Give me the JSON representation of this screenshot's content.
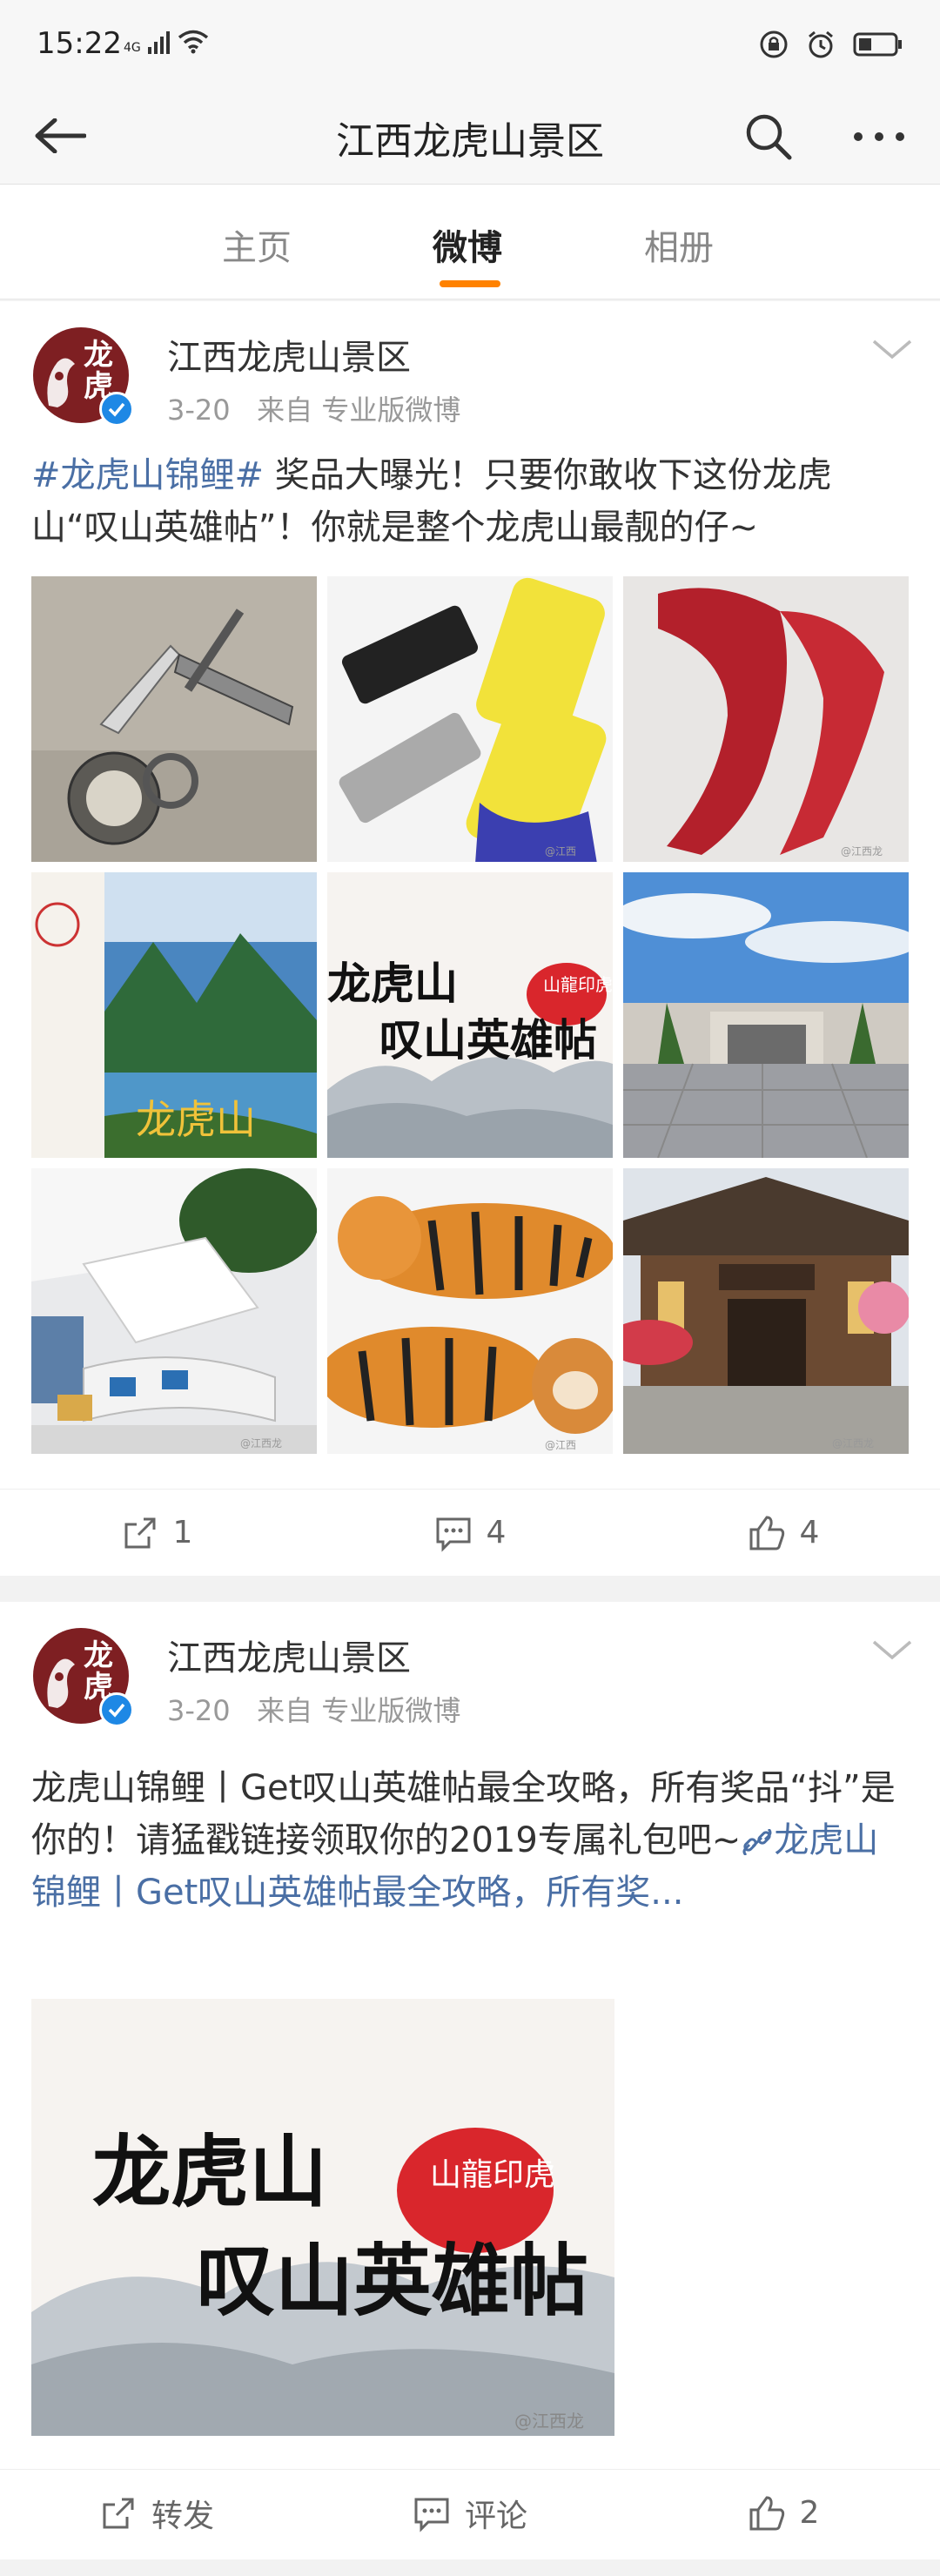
{
  "status": {
    "time": "15:22",
    "network": "4G"
  },
  "nav": {
    "title": "江西龙虎山景区",
    "back_icon": "back-arrow-icon",
    "search_icon": "search-icon",
    "more_icon": "more-dots-icon"
  },
  "tabs": [
    {
      "label": "主页"
    },
    {
      "label": "微博"
    },
    {
      "label": "相册"
    }
  ],
  "accent_color": "#ff8200",
  "link_color": "#4a6fa5",
  "posts": [
    {
      "user": "江西龙虎山景区",
      "avatar_text": "龙虎",
      "date": "3-20",
      "source": "来自 专业版微博",
      "hashtag": "#龙虎山锦鲤#",
      "text": " 奖品大曝光！只要你敢收下这份龙虎山“叹山英雄帖”！你就是整个龙虎山最靓的仔~",
      "images": [
        {
          "desc": "keychain-tools"
        },
        {
          "desc": "combs-phonecases",
          "watermark": "@江西"
        },
        {
          "desc": "red-scarf",
          "watermark": "@江西龙"
        },
        {
          "desc": "tickets-landscape",
          "caption": "龙虎山"
        },
        {
          "desc": "invitation-card",
          "caption1": "龙虎山",
          "caption2": "叹山英雄帖",
          "seal": "山龍印虎"
        },
        {
          "desc": "museum-building"
        },
        {
          "desc": "visitor-center",
          "watermark": "@江西龙"
        },
        {
          "desc": "tiger-plush",
          "watermark": "@江西"
        },
        {
          "desc": "teahouse",
          "watermark": "@江西龙"
        }
      ],
      "actions": {
        "repost": "1",
        "comment": "4",
        "like": "4"
      }
    },
    {
      "user": "江西龙虎山景区",
      "avatar_text": "龙虎",
      "date": "3-20",
      "source": "来自 专业版微博",
      "text": "龙虎山锦鲤丨Get叹山英雄帖最全攻略，所有奖品“抖”是你的！请猛戳链接领取你的2019专属礼包吧~",
      "link": "龙虎山锦鲤丨Get叹山英雄帖最全攻略，所有奖...",
      "image": {
        "caption1": "龙虎山",
        "caption2": "叹山英雄帖",
        "seal": "山龍印虎",
        "watermark": "@江西龙"
      },
      "actions": {
        "repost": "转发",
        "comment": "评论",
        "like": "2"
      }
    }
  ]
}
